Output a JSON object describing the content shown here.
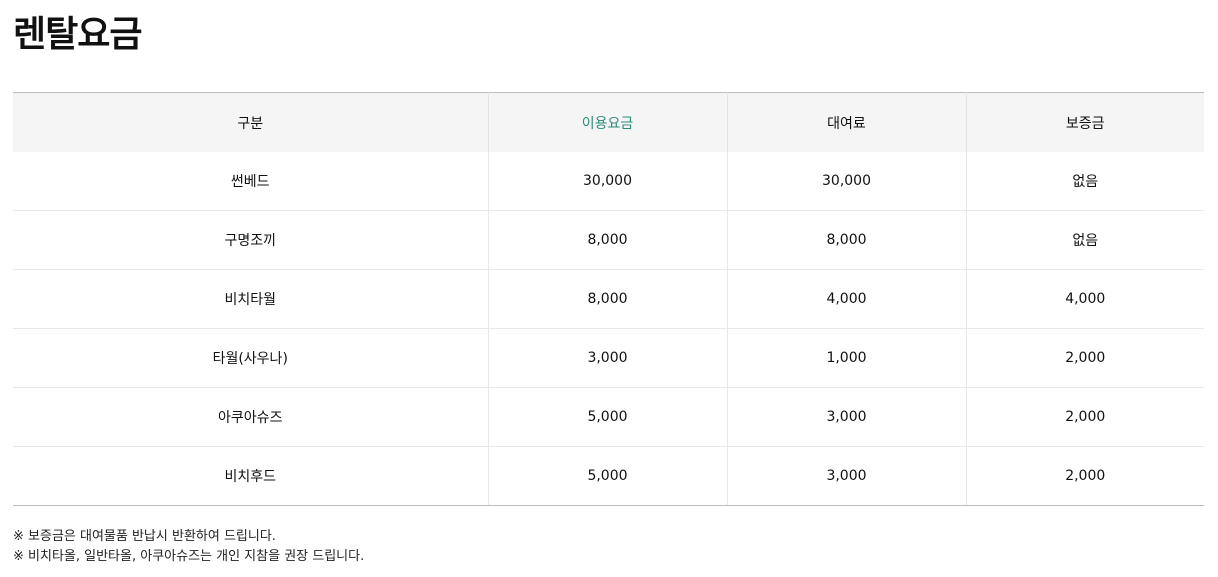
{
  "page": {
    "title": "렌탈요금"
  },
  "table": {
    "headers": [
      "구분",
      "이용요금",
      "대여료",
      "보증금"
    ],
    "rows": [
      [
        "썬베드",
        "30,000",
        "30,000",
        "없음"
      ],
      [
        "구명조끼",
        "8,000",
        "8,000",
        "없음"
      ],
      [
        "비치타월",
        "8,000",
        "4,000",
        "4,000"
      ],
      [
        "타월(사우나)",
        "3,000",
        "1,000",
        "2,000"
      ],
      [
        "아쿠아슈즈",
        "5,000",
        "3,000",
        "2,000"
      ],
      [
        "비치후드",
        "5,000",
        "3,000",
        "2,000"
      ]
    ],
    "accent_color": "#2e8b7a"
  },
  "notes": [
    "※ 보증금은 대여물품 반납시 반환하여 드립니다.",
    "※ 비치타올, 일반타올, 아쿠아슈즈는 개인 지참을 권장 드립니다."
  ]
}
